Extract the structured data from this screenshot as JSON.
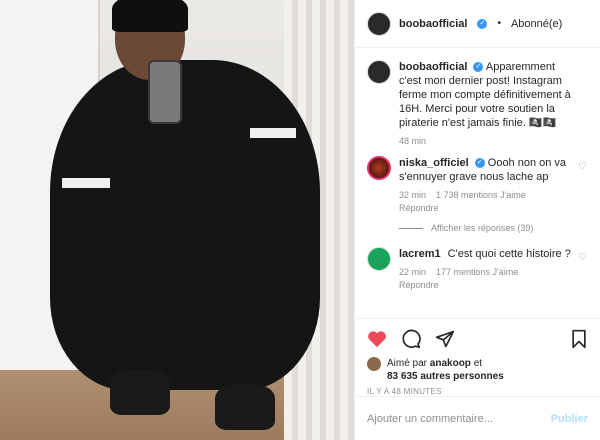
{
  "post": {
    "author": "boobaofficial",
    "follow_status": "Abonné(e)",
    "separator": "•"
  },
  "caption": {
    "author": "boobaofficial",
    "text": "Apparemment c'est mon dernier post! Instagram ferme mon compte définitivement à 16H. Merci pour votre soutien la piraterie n'est jamais finie. 🏴‍☠️🏴‍☠️",
    "time": "48 min"
  },
  "comments": [
    {
      "author": "niska_officiel",
      "text": "Oooh non on va s'ennuyer grave nous lache ap",
      "time": "32 min",
      "likes": "1 738 mentions J'aime",
      "reply": "Répondre",
      "view_replies": "Afficher les réponses (39)"
    },
    {
      "author": "lacrem1",
      "text": "C'est quoi cette histoire ?",
      "time": "22 min",
      "likes": "177 mentions J'aime",
      "reply": "Répondre"
    }
  ],
  "likes": {
    "liked_by_prefix": "Aimé par",
    "liked_by_user": "anakoop",
    "and": "et",
    "others": "83 635 autres personnes"
  },
  "timestamp": "IL Y A 48 MINUTES",
  "add_comment": {
    "placeholder": "Ajouter un commentaire...",
    "publish_label": "Publier"
  },
  "colors": {
    "like_red": "#ed4956",
    "verified_blue": "#3897f0",
    "publish_disabled": "#b2dffc"
  }
}
